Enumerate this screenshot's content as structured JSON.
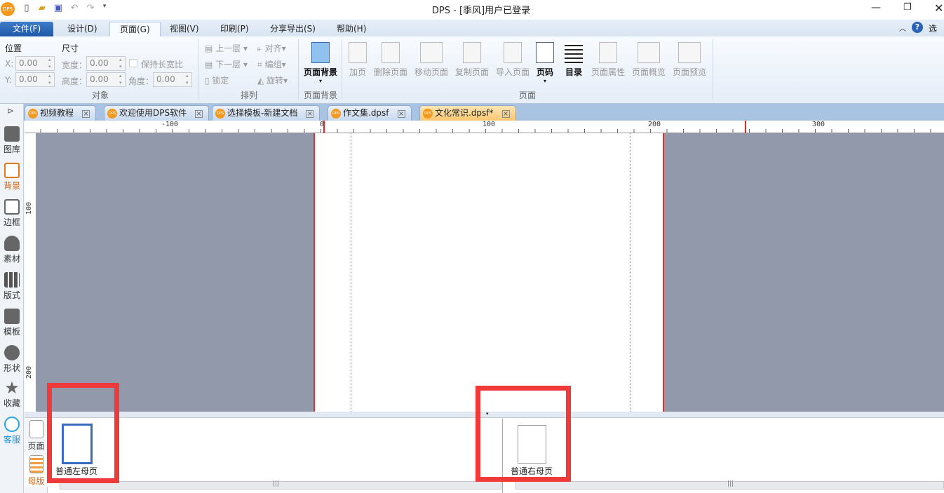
{
  "window": {
    "title": "DPS - [季风]用户已登录",
    "logo": "DPS"
  },
  "menu": {
    "tabs": [
      "文件(F)",
      "设计(D)",
      "页面(G)",
      "视图(V)",
      "印刷(P)",
      "分享导出(S)",
      "帮助(H)"
    ],
    "options": "选项"
  },
  "ribbon": {
    "position": {
      "label": "位置",
      "x_label": "X:",
      "x": "0.00",
      "y_label": "Y:",
      "y": "0.00"
    },
    "size": {
      "label": "尺寸",
      "width_label": "宽度：",
      "width": "0.00",
      "height_label": "高度：",
      "height": "0.00",
      "keep_ratio": "保持长宽比",
      "angle_label": "角度：",
      "angle": "0.00"
    },
    "object_group": "对象",
    "arrange": {
      "up": "上一层",
      "down": "下一层",
      "lock": "锁定",
      "align": "对齐",
      "group": "编组",
      "rotate": "旋转",
      "group_label": "排列"
    },
    "page_bg": {
      "label": "页面背景",
      "group_label": "页面背景"
    },
    "page": {
      "buttons": [
        "加页",
        "删除页面",
        "移动页面",
        "复制页面",
        "导入页面",
        "页码",
        "目录",
        "页面属性",
        "页面概览",
        "页面预览"
      ],
      "group_label": "页面"
    }
  },
  "doc_tabs": [
    {
      "label": "视频教程"
    },
    {
      "label": "欢迎使用DPS软件"
    },
    {
      "label": "选择模板-新建文档"
    },
    {
      "label": "作文集.dpsf"
    },
    {
      "label": "文化常识.dpsf*",
      "active": true
    }
  ],
  "sidebar": [
    "图库",
    "背景",
    "边框",
    "素材",
    "版式",
    "模板",
    "形状",
    "收藏",
    "客服"
  ],
  "ruler": {
    "h": [
      "-100",
      "0",
      "100",
      "200",
      "300"
    ],
    "v": [
      "100",
      "200"
    ]
  },
  "bottom": {
    "tabs": [
      "页面",
      "母版"
    ],
    "left_master": "普通左母页",
    "right_master": "普通右母页"
  }
}
